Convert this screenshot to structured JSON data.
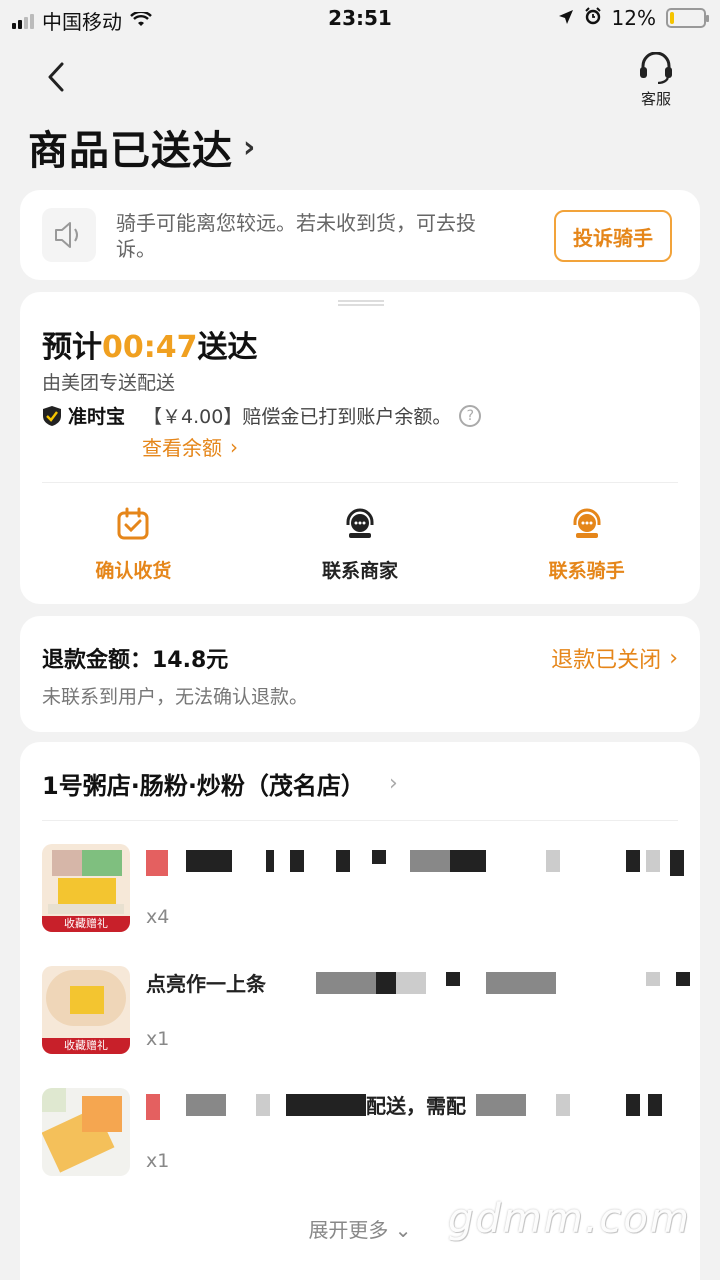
{
  "status_bar": {
    "carrier": "中国移动",
    "time": "23:51",
    "battery": "12%",
    "battery_level": 0.12
  },
  "header": {
    "service_label": "客服",
    "title": "商品已送达"
  },
  "notice": {
    "text": "骑手可能离您较远。若未收到货，可去投诉。",
    "button": "投诉骑手"
  },
  "delivery": {
    "eta_prefix": "预计",
    "eta_time": "00:47",
    "eta_suffix": "送达",
    "deliver_by": "由美团专送配送",
    "ontime_label": "准时宝",
    "compensation_text": "【￥4.00】赔偿金已打到账户余额。",
    "view_balance": "查看余额",
    "actions": [
      {
        "label": "确认收货",
        "icon": "calendar-check-icon"
      },
      {
        "label": "联系商家",
        "icon": "contact-merchant-icon"
      },
      {
        "label": "联系骑手",
        "icon": "contact-rider-icon"
      }
    ]
  },
  "refund": {
    "amount_text": "退款金额：14.8元",
    "status": "退款已关闭",
    "note": "未联系到用户，无法确认退款。"
  },
  "order": {
    "shop_name": "1号粥店·肠粉·炒粉（茂名店）",
    "items": [
      {
        "qty": "x4",
        "tag": "收藏赠礼"
      },
      {
        "qty": "x1",
        "tag": "收藏赠礼",
        "name_visible": "点亮作一上条"
      },
      {
        "qty": "x1",
        "name_visible": "配送，需配"
      }
    ],
    "expand_label": "展开更多"
  },
  "watermark": "gdmm.com",
  "colors": {
    "accent": "#e5861a",
    "eta": "#f0a020",
    "background": "#f2f2f2"
  }
}
